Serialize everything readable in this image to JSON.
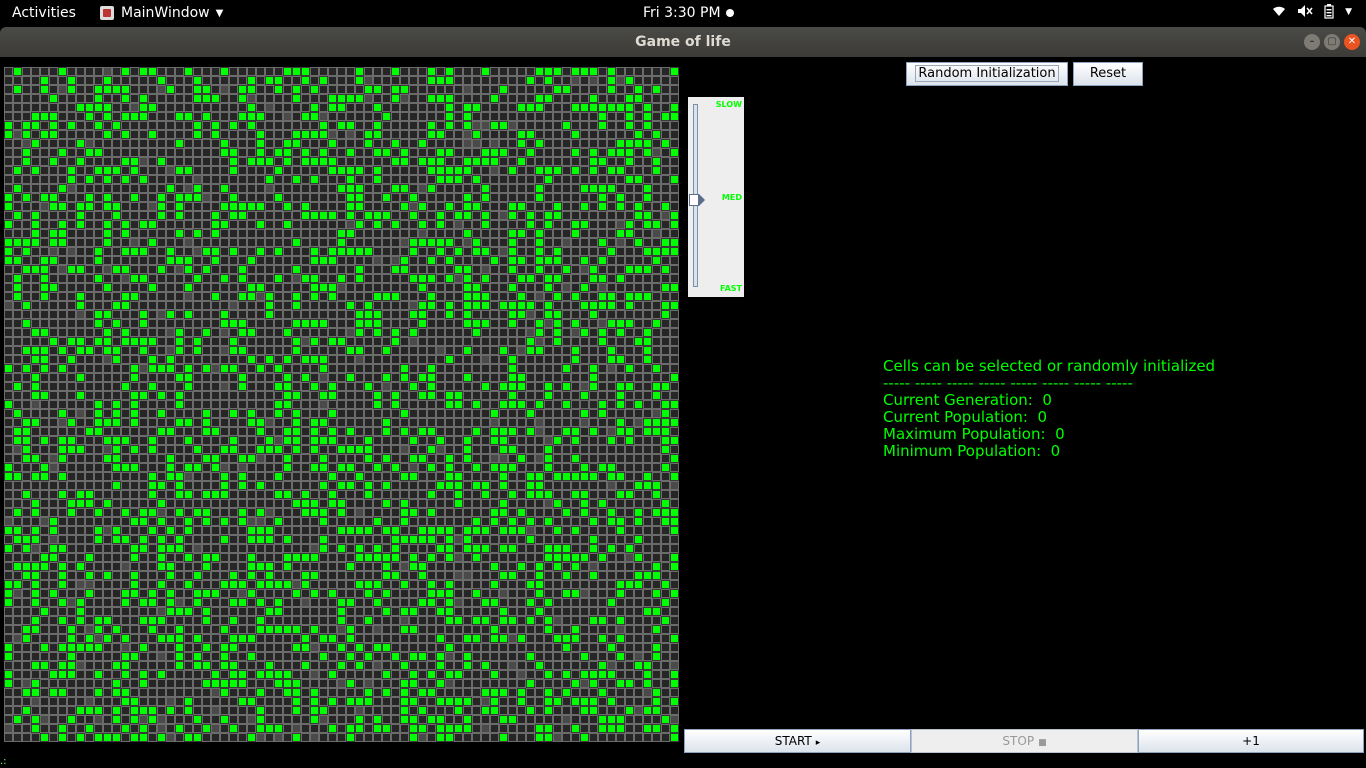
{
  "topbar": {
    "activities": "Activities",
    "app_menu": "MainWindow",
    "clock": "Fri  3:30 PM",
    "tray_icons": [
      "wifi-icon",
      "volume-muted-icon",
      "battery-icon",
      "power-menu-icon"
    ]
  },
  "window": {
    "title": "Game of life"
  },
  "controls": {
    "random_label": "Random Initialization",
    "reset_label": "Reset",
    "start_label": "START",
    "stop_label": "STOP",
    "step_label": "+1"
  },
  "speed_slider": {
    "labels": {
      "slow": "SLOW",
      "med": "MED",
      "fast": "FAST"
    },
    "value": "MED"
  },
  "info": {
    "hint": "Cells can be selected or randomly initialized",
    "separator": "----- ----- ----- ----- ----- ----- ----- -----",
    "generation": "Current Generation:  0",
    "population": "Current Population:  0",
    "max_population": "Maximum Population:  0",
    "min_population": "Minimum Population:  0"
  },
  "grid": {
    "rows": 75,
    "cols": 75,
    "alive_color": "#00ff00",
    "dead_color": "#262626"
  },
  "colors": {
    "text_accent": "#00ff00",
    "background": "#000000"
  }
}
